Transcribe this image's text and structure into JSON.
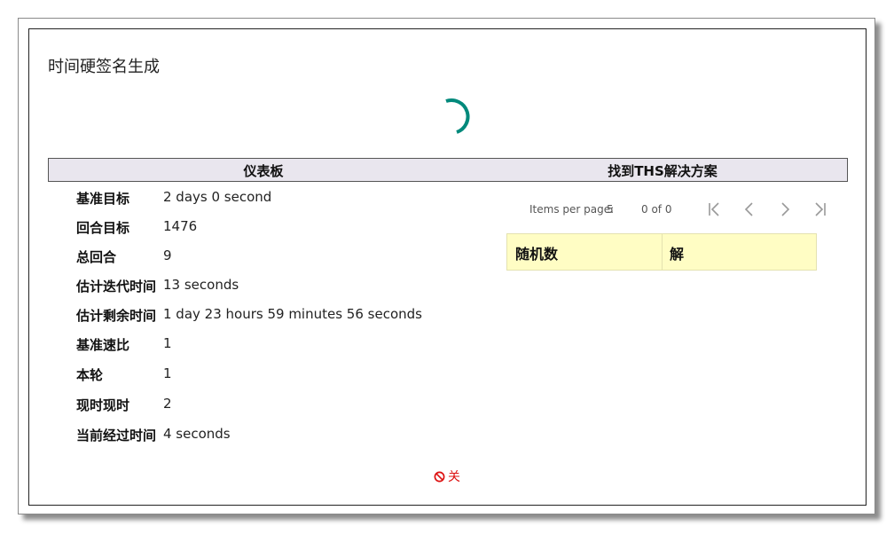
{
  "dialog": {
    "title": "时间硬签名生成",
    "close_label": "关"
  },
  "dashboard": {
    "header": "仪表板",
    "rows": [
      {
        "label": "基准目标",
        "value": "2 days 0 second"
      },
      {
        "label": "回合目标",
        "value": "1476"
      },
      {
        "label": "总回合",
        "value": "9"
      },
      {
        "label": "估计迭代时间",
        "value": "13 seconds"
      },
      {
        "label": "估计剩余时间",
        "value": "1 day 23 hours 59 minutes 56 seconds"
      },
      {
        "label": "基准速比",
        "value": "1"
      },
      {
        "label": "本轮",
        "value": "1"
      },
      {
        "label": "现时现时",
        "value": "2"
      },
      {
        "label": "当前经过时间",
        "value": "4 seconds"
      }
    ]
  },
  "solutions": {
    "header": "找到THS解决方案",
    "paginator": {
      "items_per_page_label": "Items per page:",
      "items_per_page_value": "5",
      "range_label": "0 of 0"
    },
    "columns": [
      "随机数",
      "解"
    ]
  },
  "colors": {
    "spinner": "#00897b",
    "header_bg": "#e9e6ee",
    "table_header_bg": "#fffdc4",
    "close": "#dd1111"
  },
  "icons": {
    "spinner": "loading-spinner-icon",
    "first_page": "first-page-icon",
    "prev_page": "chevron-left-icon",
    "next_page": "chevron-right-icon",
    "last_page": "last-page-icon",
    "close": "ban-icon"
  }
}
